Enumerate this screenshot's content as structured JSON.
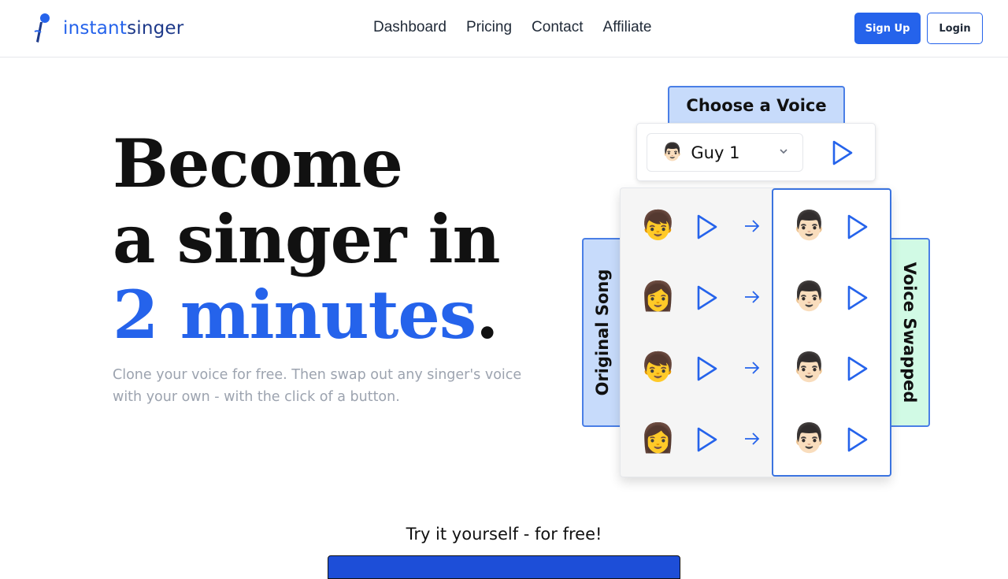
{
  "header": {
    "logo": {
      "part1": "instant",
      "part2": "singer",
      "icon": "microphone-icon"
    },
    "nav": [
      "Dashboard",
      "Pricing",
      "Contact",
      "Affiliate"
    ],
    "signup_label": "Sign Up",
    "login_label": "Login"
  },
  "hero": {
    "title_line1": "Become",
    "title_line2": "a singer in",
    "title_line3_highlight": "2 minutes",
    "title_line3_end": ".",
    "subtitle": "Clone your voice for free. Then swap out any singer's voice with your own - with the click of a button."
  },
  "demo": {
    "choose_voice_label": "Choose a Voice",
    "selected_voice": "Guy 1",
    "selected_voice_emoji": "👨🏻",
    "original_label": "Original Song",
    "swapped_label": "Voice Swapped",
    "rows": [
      {
        "original_emoji": "👦",
        "swapped_emoji": "👨🏻"
      },
      {
        "original_emoji": "👩",
        "swapped_emoji": "👨🏻"
      },
      {
        "original_emoji": "👦",
        "swapped_emoji": "👨🏻"
      },
      {
        "original_emoji": "👩",
        "swapped_emoji": "👨🏻"
      }
    ],
    "accent_color": "#2563eb"
  },
  "cta": {
    "try_text": "Try it yourself - for free!"
  }
}
